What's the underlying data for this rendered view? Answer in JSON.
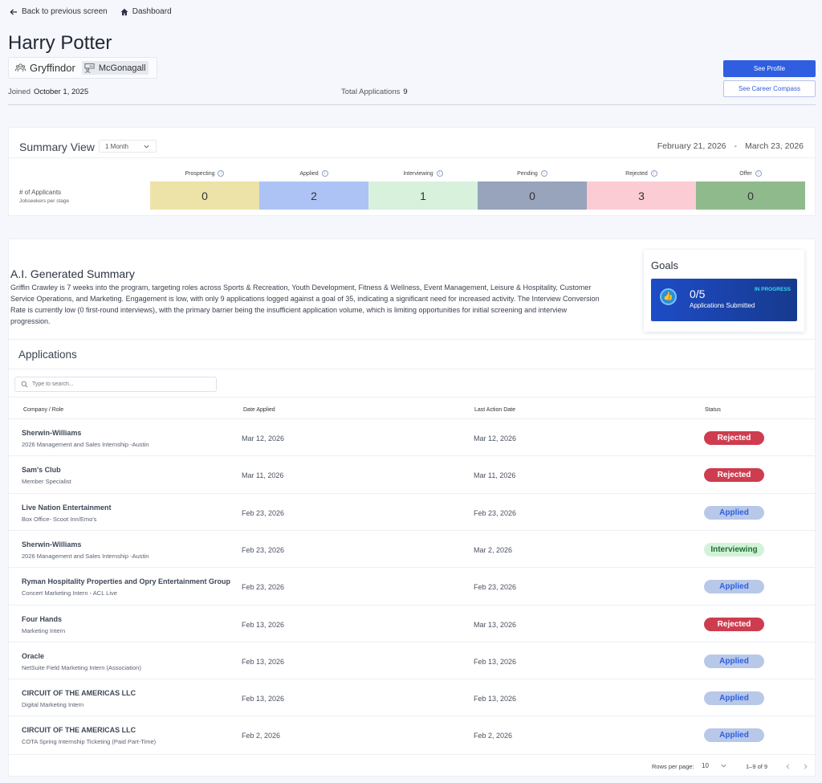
{
  "nav": {
    "back_label": "Back to previous screen",
    "dashboard_label": "Dashboard"
  },
  "profile": {
    "name": "Harry Potter",
    "house": "Gryffindor",
    "mentor": "McGonagall",
    "joined_label": "Joined",
    "joined_date": "October 1, 2025",
    "total_label": "Total Applications",
    "total_value": "9",
    "see_profile": "See Profile",
    "see_compass": "See Career Compass"
  },
  "summary": {
    "title": "Summary View",
    "period": "1 Month",
    "range_start": "February 21, 2026",
    "range_sep": "-",
    "range_end": "March 23, 2026",
    "row_label": "# of Applicants",
    "row_sub": "Jobseekers per stage",
    "stages": [
      {
        "name": "Prospecting",
        "count": "0",
        "color": "#ede3a8"
      },
      {
        "name": "Applied",
        "count": "2",
        "color": "#adc3f5"
      },
      {
        "name": "Interviewing",
        "count": "1",
        "color": "#d7f1dc"
      },
      {
        "name": "Pending",
        "count": "0",
        "color": "#98a3bc"
      },
      {
        "name": "Rejected",
        "count": "3",
        "color": "#fbccd3"
      },
      {
        "name": "Offer",
        "count": "0",
        "color": "#8fbb8c"
      }
    ]
  },
  "ai_summary": {
    "title": "A.I. Generated Summary",
    "text": "Griffin Crawley is 7 weeks into the program, targeting roles across Sports & Recreation, Youth Development, Fitness & Wellness, Event Management, Leisure & Hospitality, Customer Service Operations, and Marketing. Engagement is low, with only 9 applications logged against a goal of 35, indicating a significant need for increased activity. The Interview Conversion Rate is currently low (0 first-round interviews), with the primary barrier being the insufficient application volume, which is limiting opportunities for initial screening and interview progression."
  },
  "goals": {
    "title": "Goals",
    "count": "0/5",
    "label": "Applications Submitted",
    "status": "IN PROGRESS"
  },
  "applications": {
    "title": "Applications",
    "search_placeholder": "Type to search...",
    "headers": {
      "company": "Company / Role",
      "date_applied": "Date Applied",
      "last_action": "Last Action Date",
      "status": "Status"
    },
    "rows": [
      {
        "company": "Sherwin-Williams",
        "role": "2026 Management and Sales Internship -Austin",
        "date_applied": "Mar 12, 2026",
        "last_action": "Mar 12, 2026",
        "status": "Rejected",
        "status_type": "rejected"
      },
      {
        "company": "Sam's Club",
        "role": "Member Specialist",
        "date_applied": "Mar 11, 2026",
        "last_action": "Mar 11, 2026",
        "status": "Rejected",
        "status_type": "rejected"
      },
      {
        "company": "Live Nation Entertainment",
        "role": "Box Office- Scoot Inn/Emo's",
        "date_applied": "Feb 23, 2026",
        "last_action": "Feb 23, 2026",
        "status": "Applied",
        "status_type": "applied"
      },
      {
        "company": "Sherwin-Williams",
        "role": "2026 Management and Sales Internship -Austin",
        "date_applied": "Feb 23, 2026",
        "last_action": "Mar 2, 2026",
        "status": "Interviewing",
        "status_type": "interviewing"
      },
      {
        "company": "Ryman Hospitality Properties and Opry Entertainment Group",
        "role": "Concert Marketing Intern - ACL Live",
        "date_applied": "Feb 23, 2026",
        "last_action": "Feb 23, 2026",
        "status": "Applied",
        "status_type": "applied"
      },
      {
        "company": "Four Hands",
        "role": "Marketing Intern",
        "date_applied": "Feb 13, 2026",
        "last_action": "Mar 13, 2026",
        "status": "Rejected",
        "status_type": "rejected"
      },
      {
        "company": "Oracle",
        "role": "NetSuite Field Marketing Intern (Association)",
        "date_applied": "Feb 13, 2026",
        "last_action": "Feb 13, 2026",
        "status": "Applied",
        "status_type": "applied"
      },
      {
        "company": "CIRCUIT OF THE AMERICAS LLC",
        "role": "Digital Marketing Intern",
        "date_applied": "Feb 13, 2026",
        "last_action": "Feb 13, 2026",
        "status": "Applied",
        "status_type": "applied"
      },
      {
        "company": "CIRCUIT OF THE AMERICAS LLC",
        "role": "COTA Spring Internship Ticketing (Paid Part-Time)",
        "date_applied": "Feb 2, 2026",
        "last_action": "Feb 2, 2026",
        "status": "Applied",
        "status_type": "applied"
      }
    ]
  },
  "pagination": {
    "rows_per_page_label": "Rows per page:",
    "rows_per_page": "10",
    "range": "1–9 of 9"
  }
}
